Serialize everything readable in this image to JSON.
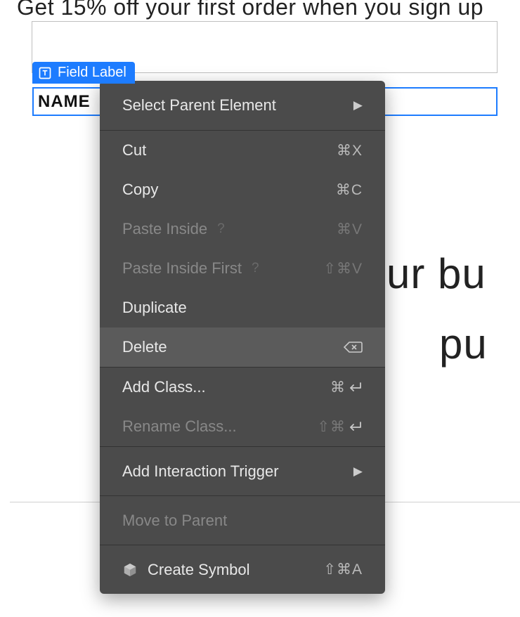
{
  "background": {
    "promo_text": "Get 15% off your first order when you sign up",
    "name_label": "NAME",
    "mid_text_1": "ur bu",
    "mid_text_2": "pu"
  },
  "label_tag": {
    "text": "Field Label"
  },
  "context_menu": {
    "select_parent": {
      "label": "Select Parent Element"
    },
    "cut": {
      "label": "Cut",
      "shortcut": "⌘X"
    },
    "copy": {
      "label": "Copy",
      "shortcut": "⌘C"
    },
    "paste_inside": {
      "label": "Paste Inside",
      "shortcut": "⌘V"
    },
    "paste_inside_first": {
      "label": "Paste Inside First",
      "shortcut": "⇧⌘V"
    },
    "duplicate": {
      "label": "Duplicate"
    },
    "delete": {
      "label": "Delete"
    },
    "add_class": {
      "label": "Add Class...",
      "shortcut": "⌘↩"
    },
    "rename_class": {
      "label": "Rename Class...",
      "shortcut": "⇧⌘↩"
    },
    "add_interaction": {
      "label": "Add Interaction Trigger"
    },
    "move_to_parent": {
      "label": "Move to Parent"
    },
    "create_symbol": {
      "label": "Create Symbol",
      "shortcut": "⇧⌘A"
    }
  }
}
